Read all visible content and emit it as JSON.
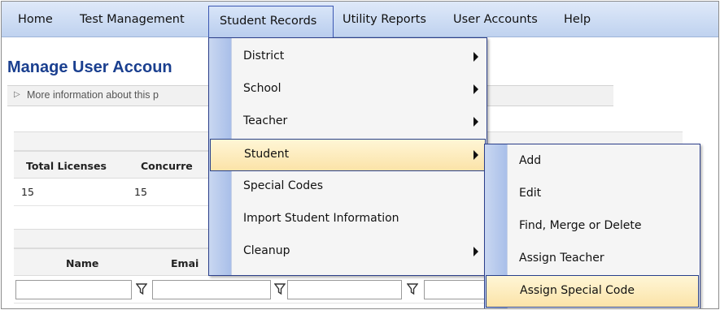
{
  "nav": {
    "items": [
      "Home",
      "Test Management",
      "Student Records",
      "Utility Reports",
      "User Accounts",
      "Help"
    ],
    "active": "Student Records"
  },
  "page": {
    "title": "Manage User Accoun",
    "info_text": "More information about this p"
  },
  "licenses_grid": {
    "headers": [
      "Total Licenses",
      "Concurre"
    ],
    "row": [
      "15",
      "15"
    ]
  },
  "users_grid": {
    "headers": [
      "Name",
      "Emai"
    ]
  },
  "student_records_menu": {
    "items": [
      {
        "label": "District",
        "submenu": true
      },
      {
        "label": "School",
        "submenu": true
      },
      {
        "label": "Teacher",
        "submenu": true
      },
      {
        "label": "Student",
        "submenu": true,
        "highlighted": true
      },
      {
        "label": "Special Codes",
        "submenu": false
      },
      {
        "label": "Import Student Information",
        "submenu": false
      },
      {
        "label": "Cleanup",
        "submenu": true
      }
    ]
  },
  "student_submenu": {
    "items": [
      {
        "label": "Add"
      },
      {
        "label": "Edit"
      },
      {
        "label": "Find, Merge or Delete"
      },
      {
        "label": "Assign Teacher"
      },
      {
        "label": "Assign Special Code",
        "highlighted": true
      }
    ]
  },
  "colors": {
    "nav_bg": "#c9d8f2",
    "menu_border": "#2c3f8a",
    "highlight": "#fbe3a8",
    "title": "#1a3f8f"
  }
}
